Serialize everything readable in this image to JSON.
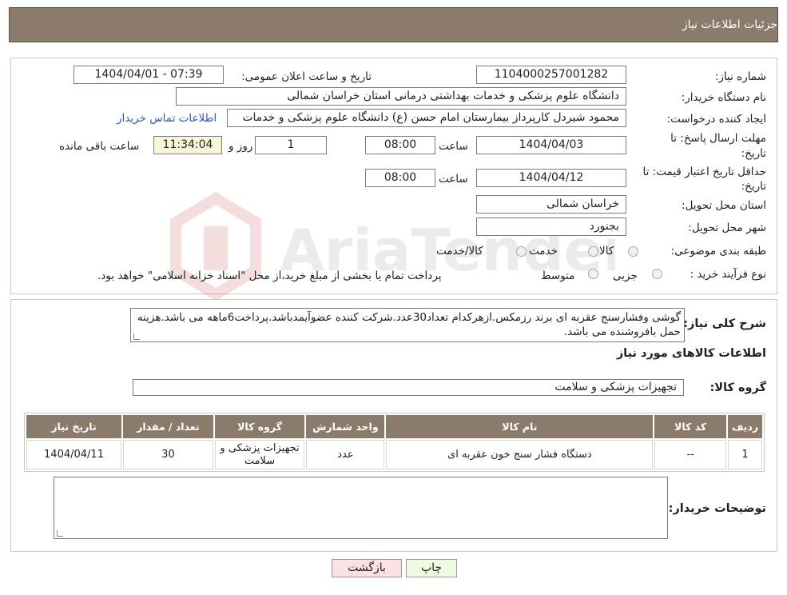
{
  "header": {
    "title": "جزئیات اطلاعات نیاز"
  },
  "info": {
    "need_number_label": "شماره نیاز:",
    "need_number": "1104000257001282",
    "announce_label": "تاریخ و ساعت اعلان عمومی:",
    "announce_value": "1404/04/01 - 07:39",
    "buyer_org_label": "نام دستگاه خریدار:",
    "buyer_org": "دانشگاه علوم پزشکی و خدمات بهداشتی درمانی استان خراسان شمالی",
    "requester_label": "ایجاد کننده درخواست:",
    "requester": "محمود شیردل کارپرداز بیمارستان امام حسن (ع) دانشگاه علوم پزشکی و خدمات",
    "contact_link": "اطلاعات تماس خریدار",
    "deadline_label_1": "مهلت ارسال پاسخ: تا",
    "deadline_label_2": "تاریخ:",
    "deadline_date": "1404/04/03",
    "time_label": "ساعت",
    "deadline_time": "08:00",
    "days_value": "1",
    "days_label": "روز و",
    "remaining_time": "11:34:04",
    "remaining_label": "ساعت باقی مانده",
    "validity_label_1": "حداقل تاریخ اعتبار قیمت: تا",
    "validity_label_2": "تاریخ:",
    "validity_date": "1404/04/12",
    "validity_time": "08:00",
    "province_label": "استان محل تحویل:",
    "province": "خراسان شمالی",
    "city_label": "شهر محل تحویل:",
    "city": "بجنورد",
    "category_label": "طبقه بندی موضوعی:",
    "category_options": [
      "کالا",
      "خدمت",
      "کالا/خدمت"
    ],
    "process_label": "نوع فرآیند خرید :",
    "process_options": [
      "جزیی",
      "متوسط"
    ],
    "process_note": "پرداخت تمام یا بخشی از مبلغ خرید،از محل \"اسناد خزانه اسلامی\" خواهد بود."
  },
  "watermark": {
    "text": "AriaTender.net"
  },
  "details": {
    "description_label": "شرح کلی نیاز:",
    "description": "گوشی وفشارسنج عقربه ای برند رزمکس.ازهرکدام تعداد30عدد.شرکت کننده عضوآیمدباشد.پرداخت6ماهه می باشد.هزینه حمل بافروشنده می باشد.",
    "items_title": "اطلاعات کالاهای مورد نیاز",
    "group_label": "گروه کالا:",
    "group_value": "تجهیزات پزشکی و سلامت",
    "table": {
      "headers": [
        "ردیف",
        "کد کالا",
        "نام کالا",
        "واحد شمارش",
        "گروه کالا",
        "تعداد / مقدار",
        "تاریخ نیاز"
      ],
      "rows": [
        [
          "1",
          "--",
          "دستگاه فشار سنج خون عقربه ای",
          "عدد",
          "تجهیزات پزشکی و سلامت",
          "30",
          "1404/04/11"
        ]
      ]
    },
    "buyer_notes_label": "توضیحات خریدار:",
    "buyer_notes": ""
  },
  "buttons": {
    "print": "چاپ",
    "back": "بازگشت"
  },
  "colors": {
    "header_bg": "#8b7b6b",
    "print_bg": "#eefbe0",
    "back_bg": "#fbe1e1",
    "link": "#2c57b8"
  }
}
